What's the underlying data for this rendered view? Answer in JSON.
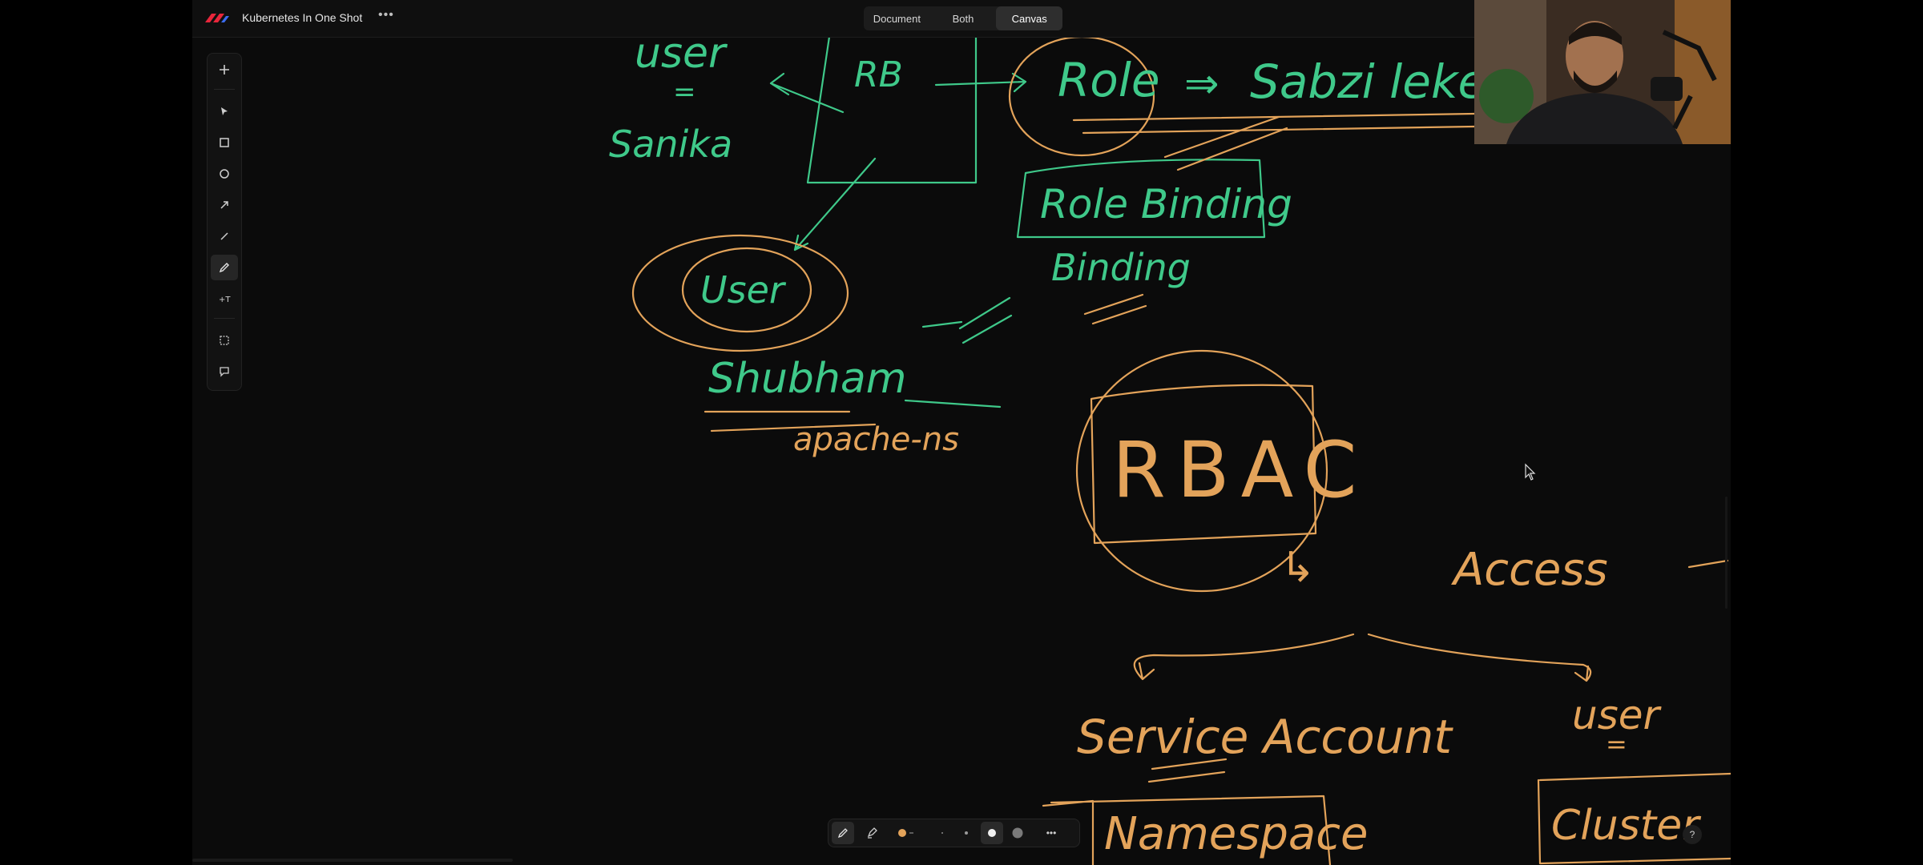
{
  "app": {
    "title": "Kubernetes In One Shot",
    "more_label": "•••"
  },
  "view_switch": {
    "options": [
      "Document",
      "Both",
      "Canvas"
    ],
    "selected": "Canvas"
  },
  "toolbar": {
    "tools": [
      "add-icon",
      "select-icon",
      "rectangle-icon",
      "ellipse-icon",
      "arrow-icon",
      "line-icon",
      "pencil-icon",
      "text-icon",
      "frame-icon",
      "comment-icon"
    ],
    "active_tool": "pencil-icon"
  },
  "canvas": {
    "handwriting": {
      "user_top": "user",
      "equals_top": "=",
      "sanika": "Sanika",
      "rb": "RB",
      "role": "Role",
      "arrow_eq": "⇒",
      "sabzi": "Sabzi leke",
      "role_binding": "Role Binding",
      "binding": "Binding",
      "user_circle": "User",
      "shubham": "Shubham",
      "apache_ns": "apache-ns",
      "rbac": "RBAC",
      "access_arrow": "↳",
      "access": "Access",
      "service_account": "Service Account",
      "user_right": "user",
      "equals_right": "=",
      "namespace": "Namespace",
      "cluster": "Cluster"
    },
    "colors": {
      "green": "#3fc98a",
      "orange": "#e3a35a"
    }
  },
  "bottom_toolbar": {
    "tools": [
      "pen-icon",
      "highlighter-icon",
      "color-orange-icon",
      "size-xs-icon",
      "size-s-icon",
      "size-m-icon",
      "size-l-icon",
      "more-icon"
    ],
    "more_label": "•••"
  },
  "help": {
    "label": "?"
  }
}
